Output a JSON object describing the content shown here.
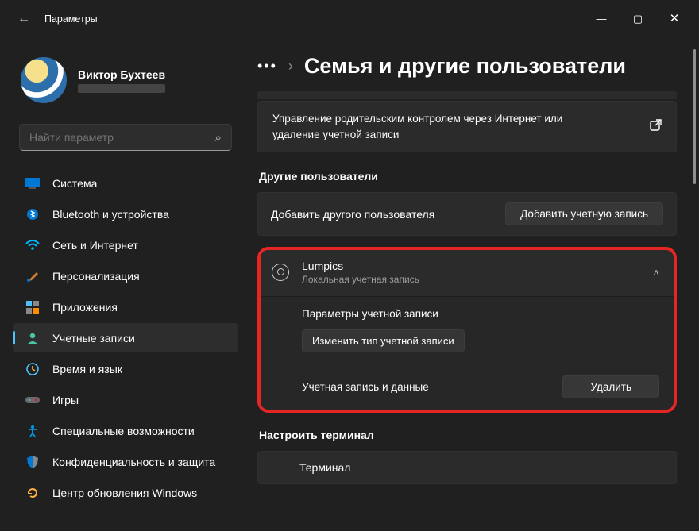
{
  "window": {
    "title": "Параметры"
  },
  "profile": {
    "name": "Виктор Бухтеев"
  },
  "search": {
    "placeholder": "Найти параметр"
  },
  "nav": {
    "items": [
      {
        "label": "Система"
      },
      {
        "label": "Bluetooth и устройства"
      },
      {
        "label": "Сеть и Интернет"
      },
      {
        "label": "Персонализация"
      },
      {
        "label": "Приложения"
      },
      {
        "label": "Учетные записи"
      },
      {
        "label": "Время и язык"
      },
      {
        "label": "Игры"
      },
      {
        "label": "Специальные возможности"
      },
      {
        "label": "Конфиденциальность и защита"
      },
      {
        "label": "Центр обновления Windows"
      }
    ]
  },
  "breadcrumb": {
    "title": "Семья и другие пользователи"
  },
  "family_card": {
    "text": "Управление родительским контролем через Интернет или удаление учетной записи"
  },
  "other_users": {
    "heading": "Другие пользователи",
    "add_label": "Добавить другого пользователя",
    "add_button": "Добавить учетную запись"
  },
  "user_panel": {
    "name": "Lumpics",
    "subtitle": "Локальная учетная запись",
    "options_heading": "Параметры учетной записи",
    "change_type_button": "Изменить тип учетной записи",
    "data_heading": "Учетная запись и данные",
    "delete_button": "Удалить"
  },
  "terminal": {
    "heading": "Настроить терминал",
    "row_label": "Терминал"
  }
}
